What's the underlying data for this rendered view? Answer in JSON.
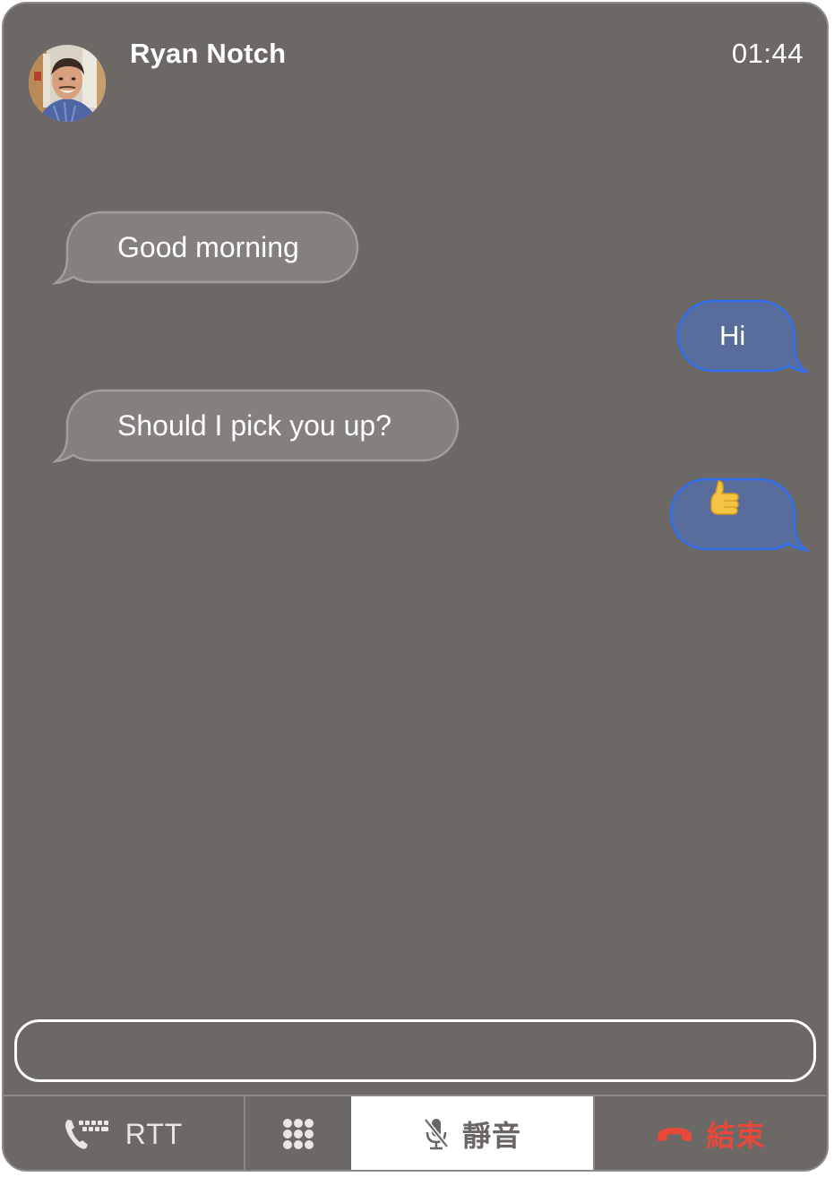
{
  "call": {
    "contact_name": "Ryan Notch",
    "timer": "01:44",
    "avatar_icon": "contact-photo"
  },
  "messages": [
    {
      "sender": "contact",
      "text": "Good morning"
    },
    {
      "sender": "me",
      "text": "Hi"
    },
    {
      "sender": "contact",
      "text": "Should I pick you up?"
    },
    {
      "sender": "me",
      "text": "👍"
    }
  ],
  "input": {
    "value": "",
    "placeholder": ""
  },
  "toolbar": {
    "rtt": {
      "label": "RTT",
      "icon": "rtt-phone-keyboard-icon"
    },
    "keypad": {
      "label": "",
      "icon": "keypad-icon"
    },
    "mute": {
      "label": "靜音",
      "icon": "mic-slash-icon",
      "active": true
    },
    "end": {
      "label": "結束",
      "icon": "phone-down-icon"
    }
  },
  "colors": {
    "background": "#6c6865",
    "incoming_bubble": "#83807d",
    "incoming_border": "#a19e9b",
    "outgoing_bubble": "#586d9c",
    "outgoing_border": "#2f6ff0",
    "end_call": "#e8483a",
    "mute_active_bg": "#ffffff"
  }
}
